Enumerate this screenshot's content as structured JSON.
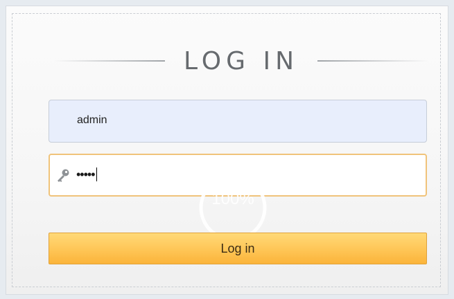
{
  "login_form": {
    "title": "LOG IN",
    "username_value": "admin",
    "password_value": "•••••",
    "loader_text": "100%",
    "submit_label": "Log in"
  },
  "icons": {
    "password_field_icon": "key-icon"
  },
  "colors": {
    "button_top": "#ffd978",
    "button_bottom": "#fbb43a",
    "button_border": "#e0a23b",
    "username_bg": "#e8eefc",
    "password_border": "#f0c37a"
  }
}
